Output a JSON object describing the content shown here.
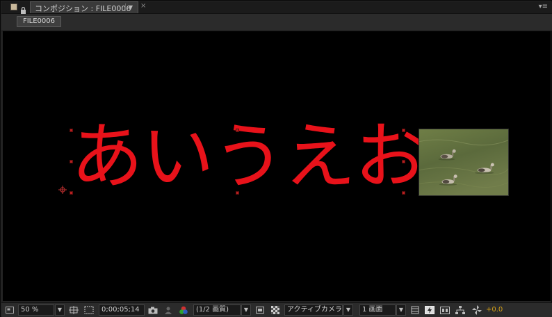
{
  "tab": {
    "title": "コンポジション : FILE0006",
    "dropdown": "▼",
    "close": "×",
    "panel_menu": "▾≡"
  },
  "breadcrumb": {
    "label": "FILE0006"
  },
  "viewer": {
    "text": "あいうえお"
  },
  "toolbar": {
    "zoom": "50 %",
    "timecode": "0;00;05;14",
    "resolution": "(1/2 画質)",
    "camera": "アクティブカメラ",
    "views": "1 画面",
    "exposure": "+0.0",
    "dropdown": "▼"
  },
  "colors": {
    "text_red": "#e8121a",
    "exposure_orange": "#d4a017",
    "panel_bg": "#232323"
  }
}
